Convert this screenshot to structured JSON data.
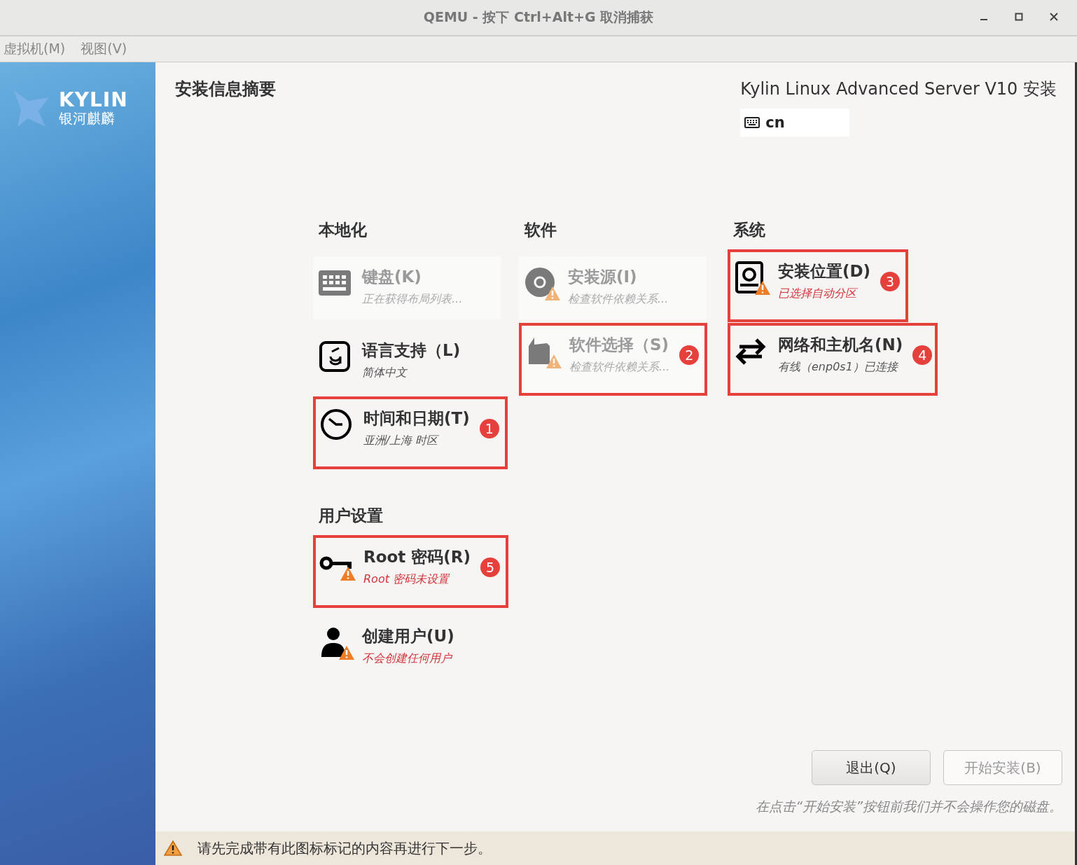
{
  "window": {
    "title": "QEMU - 按下 Ctrl+Alt+G 取消捕获"
  },
  "menu": [
    "虚拟机(M)",
    "视图(V)"
  ],
  "sidebar": {
    "logo_text": "KYLIN",
    "logo_subtext": "银河麒麟"
  },
  "header": {
    "title": "安装信息摘要",
    "product": "Kylin Linux Advanced Server V10 安装",
    "keyboard_layout": "cn"
  },
  "sections": [
    {
      "title": "本地化",
      "items": [
        {
          "title": "键盘(K)",
          "status": "正在获得布局列表...",
          "disabled": true,
          "warning": false,
          "error": false
        },
        {
          "title": "语言支持（L)",
          "status": "简体中文",
          "disabled": false,
          "warning": false,
          "error": false
        },
        {
          "title": "时间和日期(T)",
          "status": "亚洲/上海 时区",
          "disabled": false,
          "warning": false,
          "error": false,
          "callout": "1"
        }
      ]
    },
    {
      "title": "软件",
      "items": [
        {
          "title": "安装源(I)",
          "status": "检查软件依赖关系...",
          "disabled": true,
          "warning": true,
          "error": false
        },
        {
          "title": "软件选择（S)",
          "status": "检查软件依赖关系...",
          "disabled": true,
          "warning": true,
          "error": false,
          "callout": "2"
        }
      ]
    },
    {
      "title": "系统",
      "items": [
        {
          "title": "安装位置(D)",
          "status": "已选择自动分区",
          "disabled": false,
          "warning": true,
          "error": true,
          "callout": "3"
        },
        {
          "title": "网络和主机名(N)",
          "status": "有线（enp0s1）已连接",
          "disabled": false,
          "warning": false,
          "error": false,
          "callout": "4"
        }
      ]
    },
    {
      "title": "用户设置",
      "items": [
        {
          "title": "Root 密码(R)",
          "status": "Root 密码未设置",
          "disabled": false,
          "warning": true,
          "error": true,
          "callout": "5"
        },
        {
          "title": "创建用户(U)",
          "status": "不会创建任何用户",
          "disabled": false,
          "warning": true,
          "error": true
        }
      ]
    }
  ],
  "buttons": [
    {
      "label": "退出(Q)",
      "disabled": false
    },
    {
      "label": "开始安装(B)",
      "disabled": true
    }
  ],
  "note": "在点击“开始安装”按钮前我们并不会操作您的磁盘。",
  "status_bar": {
    "message": "请先完成带有此图标标记的内容再进行下一步。"
  }
}
